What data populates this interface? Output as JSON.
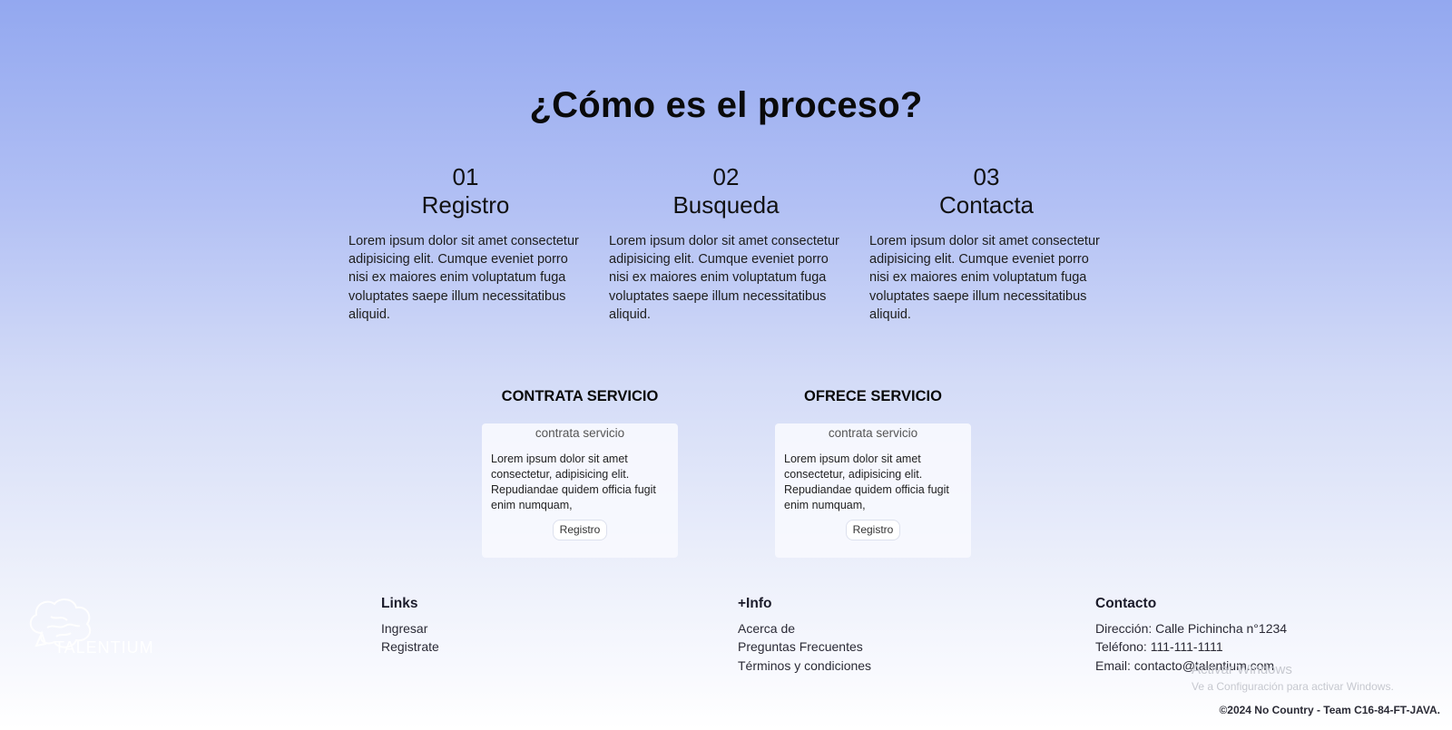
{
  "process": {
    "title": "¿Cómo es el proceso?",
    "steps": [
      {
        "number": "01",
        "name": "Registro",
        "text": "Lorem ipsum dolor sit amet consectetur adipisicing elit. Cumque eveniet porro nisi ex maiores enim voluptatum fuga voluptates saepe illum necessitatibus aliquid."
      },
      {
        "number": "02",
        "name": "Busqueda",
        "text": "Lorem ipsum dolor sit amet consectetur adipisicing elit. Cumque eveniet porro nisi ex maiores enim voluptatum fuga voluptates saepe illum necessitatibus aliquid."
      },
      {
        "number": "03",
        "name": "Contacta",
        "text": "Lorem ipsum dolor sit amet consectetur adipisicing elit. Cumque eveniet porro nisi ex maiores enim voluptatum fuga voluptates saepe illum necessitatibus aliquid."
      }
    ]
  },
  "services": [
    {
      "heading": "CONTRATA SERVICIO",
      "card_title": "contrata servicio",
      "card_text": "Lorem ipsum dolor sit amet consectetur, adipisicing elit. Repudiandae quidem officia fugit enim numquam,",
      "button": "Registro"
    },
    {
      "heading": "OFRECE SERVICIO",
      "card_title": "contrata servicio",
      "card_text": "Lorem ipsum dolor sit amet consectetur, adipisicing elit. Repudiandae quidem officia fugit enim numquam,",
      "button": "Registro"
    }
  ],
  "footer": {
    "logo_text": "TALENTIUM",
    "links": {
      "heading": "Links",
      "items": [
        "Ingresar",
        "Registrate"
      ]
    },
    "info": {
      "heading": "+Info",
      "items": [
        "Acerca de",
        "Preguntas Frecuentes",
        "Términos y condiciones"
      ]
    },
    "contact": {
      "heading": "Contacto",
      "items": [
        "Dirección: Calle Pichincha n°1234",
        "Teléfono: 111-111-1111",
        "Email: contacto@talentium.com"
      ]
    },
    "copyright": "©2024 No Country - Team C16-84-FT-JAVA."
  },
  "os_watermark": {
    "line1": "Activar Windows",
    "line2": "Ve a Configuración para activar Windows."
  },
  "colors": {
    "hero_top": "#93a8f0",
    "hero_bottom": "#eef1fb",
    "text": "#111111"
  }
}
